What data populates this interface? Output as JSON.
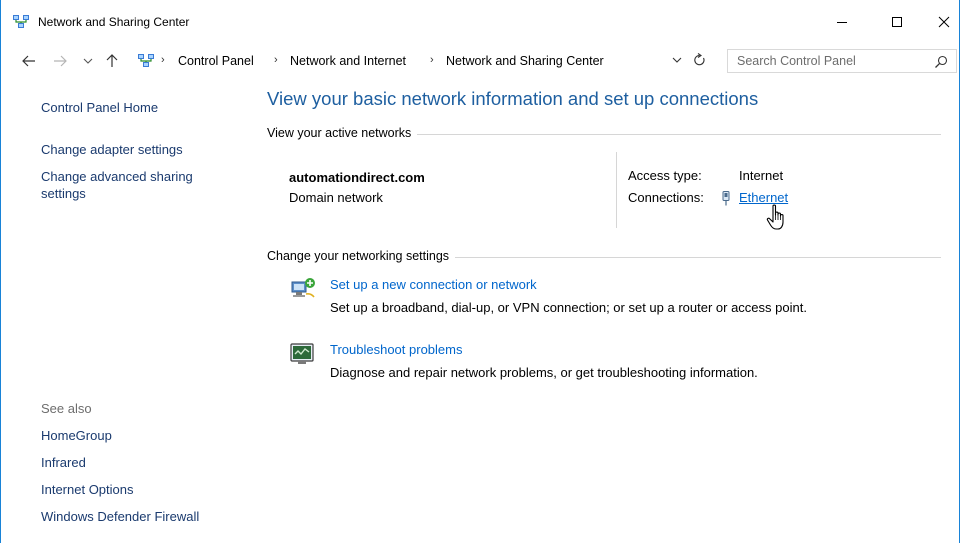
{
  "window": {
    "title": "Network and Sharing Center"
  },
  "address": {
    "crumbs": [
      "Control Panel",
      "Network and Internet",
      "Network and Sharing Center"
    ],
    "search_placeholder": "Search Control Panel"
  },
  "sidebar": {
    "links": [
      {
        "label": "Control Panel Home"
      },
      {
        "label": "Change adapter settings"
      },
      {
        "label": "Change advanced sharing settings"
      }
    ],
    "see_also_label": "See also",
    "see_also": [
      {
        "label": "HomeGroup"
      },
      {
        "label": "Infrared"
      },
      {
        "label": "Internet Options"
      },
      {
        "label": "Windows Defender Firewall"
      }
    ]
  },
  "main": {
    "heading": "View your basic network information and set up connections",
    "active_networks_label": "View your active networks",
    "network": {
      "name": "automationdirect.com",
      "type": "Domain network",
      "access_type_label": "Access type:",
      "access_type_value": "Internet",
      "connections_label": "Connections:",
      "connection_name": "Ethernet"
    },
    "change_settings_label": "Change your networking settings",
    "tasks": [
      {
        "title": "Set up a new connection or network",
        "description": "Set up a broadband, dial-up, or VPN connection; or set up a router or access point."
      },
      {
        "title": "Troubleshoot problems",
        "description": "Diagnose and repair network problems, or get troubleshooting information."
      }
    ]
  },
  "colors": {
    "heading": "#1e5fa0",
    "link": "#0066cc",
    "window_border": "#1883d7"
  }
}
